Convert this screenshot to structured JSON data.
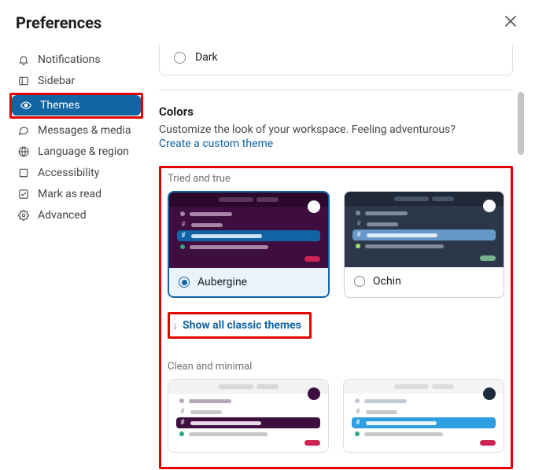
{
  "header": {
    "title": "Preferences"
  },
  "sidebar": {
    "items": [
      {
        "label": "Notifications",
        "icon": "bell-icon"
      },
      {
        "label": "Sidebar",
        "icon": "sidebar-icon"
      },
      {
        "label": "Themes",
        "icon": "eye-icon",
        "active": true
      },
      {
        "label": "Messages & media",
        "icon": "chat-icon"
      },
      {
        "label": "Language & region",
        "icon": "globe-icon"
      },
      {
        "label": "Accessibility",
        "icon": "accessibility-icon"
      },
      {
        "label": "Mark as read",
        "icon": "check-icon"
      },
      {
        "label": "Advanced",
        "icon": "gear-icon"
      }
    ]
  },
  "top_radio": {
    "label": "Dark"
  },
  "colors_section": {
    "title": "Colors",
    "description": "Customize the look of your workspace. Feeling adventurous?",
    "link": "Create a custom theme"
  },
  "tried_and_true": {
    "label": "Tried and true",
    "themes": [
      {
        "name": "Aubergine",
        "selected": true
      },
      {
        "name": "Ochin",
        "selected": false
      }
    ]
  },
  "show_all": {
    "label": "Show all classic themes"
  },
  "clean_minimal": {
    "label": "Clean and minimal"
  }
}
